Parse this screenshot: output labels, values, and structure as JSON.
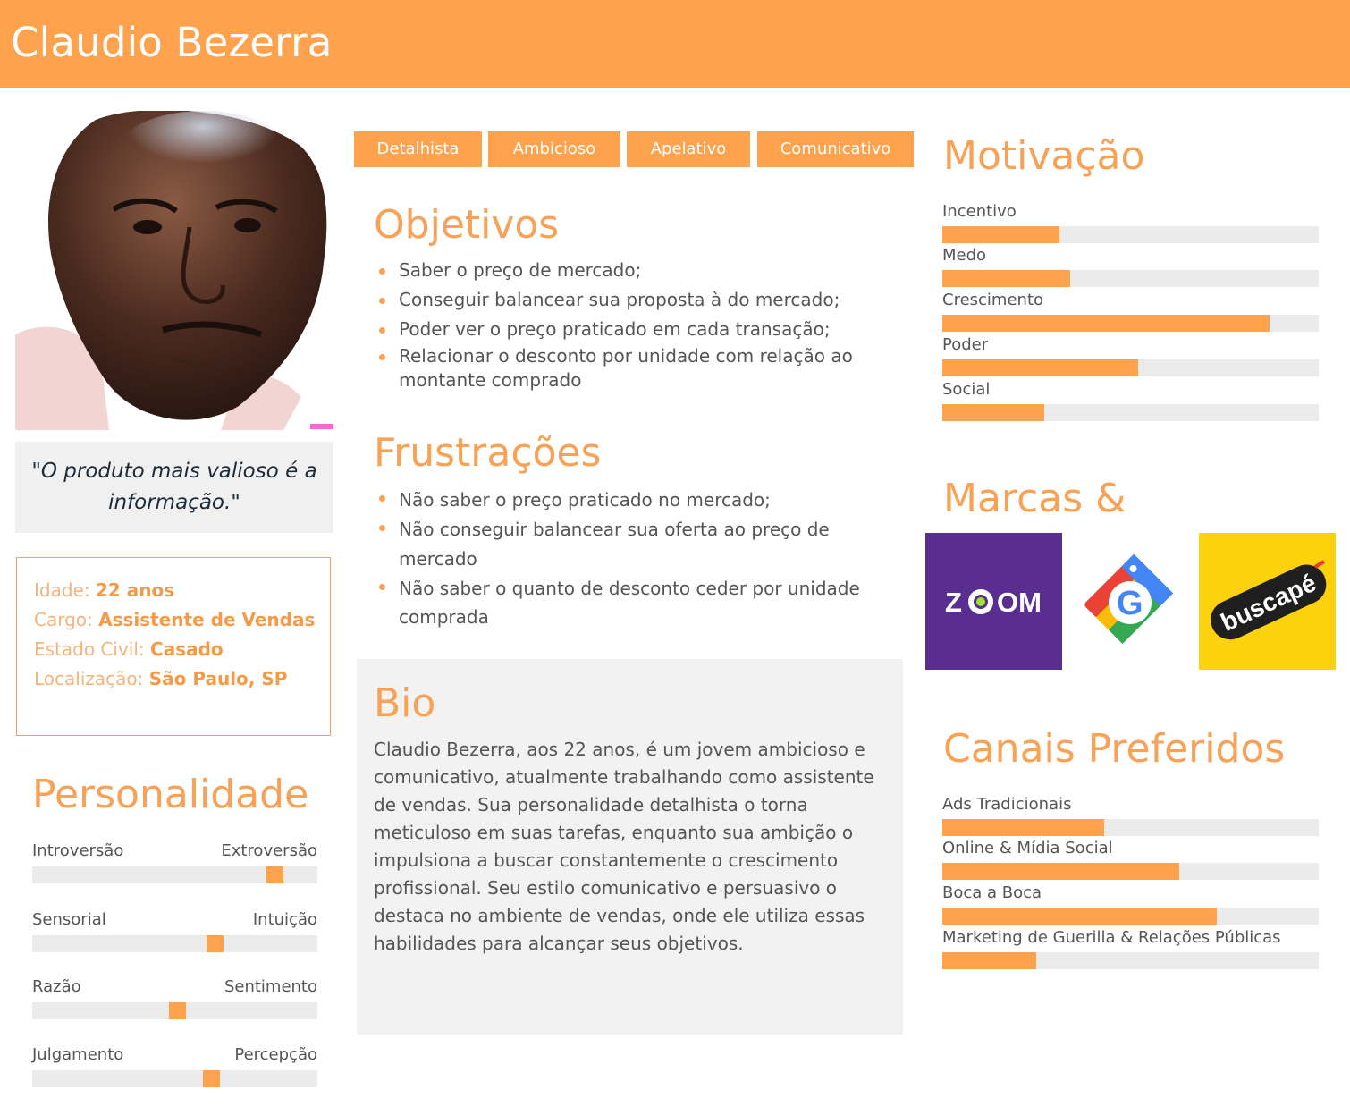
{
  "persona": {
    "name": "Claudio Bezerra",
    "quote": "\"O produto mais valioso é a informação.\""
  },
  "info": [
    {
      "label": "Idade:",
      "value": "22 anos"
    },
    {
      "label": "Cargo:",
      "value": "Assistente de Vendas"
    },
    {
      "label": "Estado Civil:",
      "value": "Casado"
    },
    {
      "label": "Localização:",
      "value": "São Paulo, SP"
    }
  ],
  "personality": {
    "title": "Personalidade",
    "traits": [
      {
        "left": "Introversão",
        "right": "Extroversão",
        "level": 0.85
      },
      {
        "left": "Sensorial",
        "right": "Intuição",
        "level": 0.64
      },
      {
        "left": "Razão",
        "right": "Sentimento",
        "level": 0.51
      },
      {
        "left": "Julgamento",
        "right": "Percepção",
        "level": 0.63
      }
    ]
  },
  "tags": [
    "Detalhista",
    "Ambicioso",
    "Apelativo",
    "Comunicativo"
  ],
  "objectives": {
    "title": "Objetivos",
    "items": [
      "Saber o preço de mercado;",
      "Conseguir balancear sua proposta à do mercado;",
      "Poder ver o preço praticado em cada transação;",
      "Relacionar o desconto por unidade com relação ao montante comprado"
    ]
  },
  "frustrations": {
    "title": "Frustrações",
    "items": [
      "Não saber o preço praticado no mercado;",
      "Não conseguir balancear sua oferta ao preço de mercado",
      "Não saber o quanto de desconto ceder por unidade comprada"
    ]
  },
  "bio": {
    "title": "Bio",
    "text": "Claudio Bezerra, aos 22 anos, é um jovem ambicioso e comunicativo, atualmente trabalhando como assistente de vendas. Sua personalidade detalhista o torna meticuloso em suas tarefas, enquanto sua ambição o impulsiona a buscar constantemente o crescimento profissional. Seu estilo comunicativo e persuasivo o destaca no ambiente de vendas, onde ele utiliza essas habilidades para alcançar seus objetivos."
  },
  "motivation": {
    "title": "Motivação",
    "items": [
      {
        "label": "Incentivo",
        "level": 0.31
      },
      {
        "label": "Medo",
        "level": 0.34
      },
      {
        "label": "Crescimento",
        "level": 0.87
      },
      {
        "label": "Poder",
        "level": 0.52
      },
      {
        "label": "Social",
        "level": 0.27
      }
    ]
  },
  "brands": {
    "title": "Marcas &",
    "items": [
      {
        "name": "ZOOM",
        "icon": "zoom-logo",
        "color": "#5a2d91"
      },
      {
        "name": "Google Shopping",
        "icon": "google-shopping-logo",
        "color": "#ffffff"
      },
      {
        "name": "buscapé",
        "icon": "buscape-logo",
        "color": "#fcd10d"
      }
    ]
  },
  "channels": {
    "title": "Canais Preferidos",
    "items": [
      {
        "label": "Ads Tradicionais",
        "level": 0.43
      },
      {
        "label": "Online & Mídia Social",
        "level": 0.63
      },
      {
        "label": "Boca a Boca",
        "level": 0.73
      },
      {
        "label": "Marketing de Guerilla & Relações Públicas",
        "level": 0.25
      }
    ]
  },
  "colors": {
    "accent": "#ffa24e",
    "track": "#ebebeb"
  }
}
